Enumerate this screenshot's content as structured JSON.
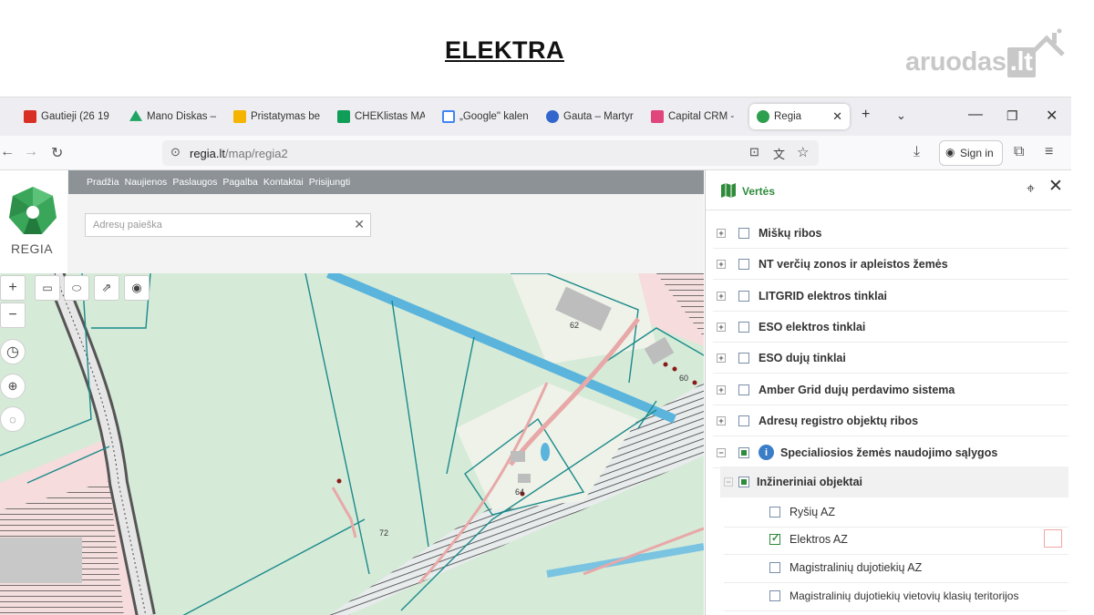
{
  "slide": {
    "title": "ELEKTRA",
    "watermark_main": "aruodas",
    "watermark_suffix": ".lt"
  },
  "browser": {
    "tabs": [
      {
        "label": "Gautieji (26 19",
        "icon": "gmail-icon",
        "color": "#d93025"
      },
      {
        "label": "Mano Diskas –",
        "icon": "google-drive-icon",
        "color": "#1fa463"
      },
      {
        "label": "Pristatymas be",
        "icon": "slides-icon",
        "color": "#f4b400"
      },
      {
        "label": "CHEKlistas MA",
        "icon": "sheets-icon",
        "color": "#0f9d58"
      },
      {
        "label": "„Google\" kalen",
        "icon": "calendar-icon",
        "color": "#4285f4"
      },
      {
        "label": "Gauta – Martyr",
        "icon": "mail-icon",
        "color": "#3366cc"
      },
      {
        "label": "Capital CRM -",
        "icon": "crm-icon",
        "color": "#e0457b"
      },
      {
        "label": "Regia",
        "icon": "regia-icon",
        "color": "#2e9e4f"
      }
    ],
    "active_tab": "Regia",
    "url_domain": "regia.lt",
    "url_path": "/map/regia2",
    "signin_label": "Sign in"
  },
  "site": {
    "menu": [
      "Pradžia",
      "Naujienos",
      "Paslaugos",
      "Pagalba",
      "Kontaktai",
      "Prisijungti"
    ],
    "logo_text": "REGIA",
    "search_placeholder": "Adresų paieška"
  },
  "map": {
    "labels": [
      "62",
      "60",
      "64",
      "72"
    ],
    "colors": {
      "parcel": "#d6ead8",
      "line": "#1a8a8a",
      "highway": "#5ab4dc",
      "hatch": "#333333",
      "road": "#e8a8a8"
    }
  },
  "panel": {
    "title": "Vertės",
    "layers": [
      {
        "label": "Miškų ribos",
        "state": "unchecked",
        "expandable": true
      },
      {
        "label": "NT verčių zonos ir apleistos žemės",
        "state": "unchecked",
        "expandable": true
      },
      {
        "label": "LITGRID elektros tinklai",
        "state": "unchecked",
        "expandable": true
      },
      {
        "label": "ESO elektros tinklai",
        "state": "unchecked",
        "expandable": true
      },
      {
        "label": "ESO dujų tinklai",
        "state": "unchecked",
        "expandable": true
      },
      {
        "label": "Amber Grid dujų perdavimo sistema",
        "state": "unchecked",
        "expandable": true
      },
      {
        "label": "Adresų registro objektų ribos",
        "state": "unchecked",
        "expandable": true
      },
      {
        "label": "Specialiosios žemės naudojimo sąlygos",
        "state": "partial",
        "expandable": true,
        "expanded": true
      }
    ],
    "group": {
      "label": "Inžineriniai objektai",
      "state": "partial"
    },
    "sublayers": [
      {
        "label": "Ryšių AZ",
        "state": "unchecked"
      },
      {
        "label": "Elektros AZ",
        "state": "checked"
      },
      {
        "label": "Magistralinių dujotiekių AZ",
        "state": "unchecked"
      },
      {
        "label": "Magistralinių dujotiekių vietovių klasių teritorijos",
        "state": "unchecked"
      }
    ]
  }
}
